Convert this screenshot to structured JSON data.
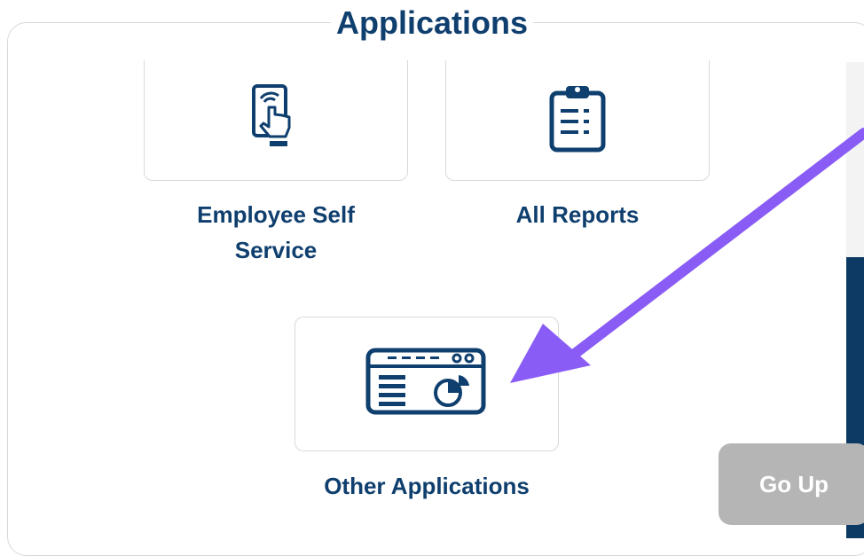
{
  "section": {
    "title": "Applications"
  },
  "apps": [
    {
      "label_line1": "Employee Self",
      "label_line2": "Service",
      "icon": "touch-device-icon"
    },
    {
      "label": "All Reports",
      "icon": "clipboard-report-icon"
    },
    {
      "label": "Other Applications",
      "icon": "dashboard-window-icon"
    }
  ],
  "go_up": {
    "label": "Go Up"
  },
  "colors": {
    "brand": "#0f3f6e",
    "annotation_arrow": "#8a5cf6",
    "go_up_bg": "#b5b5b5"
  }
}
